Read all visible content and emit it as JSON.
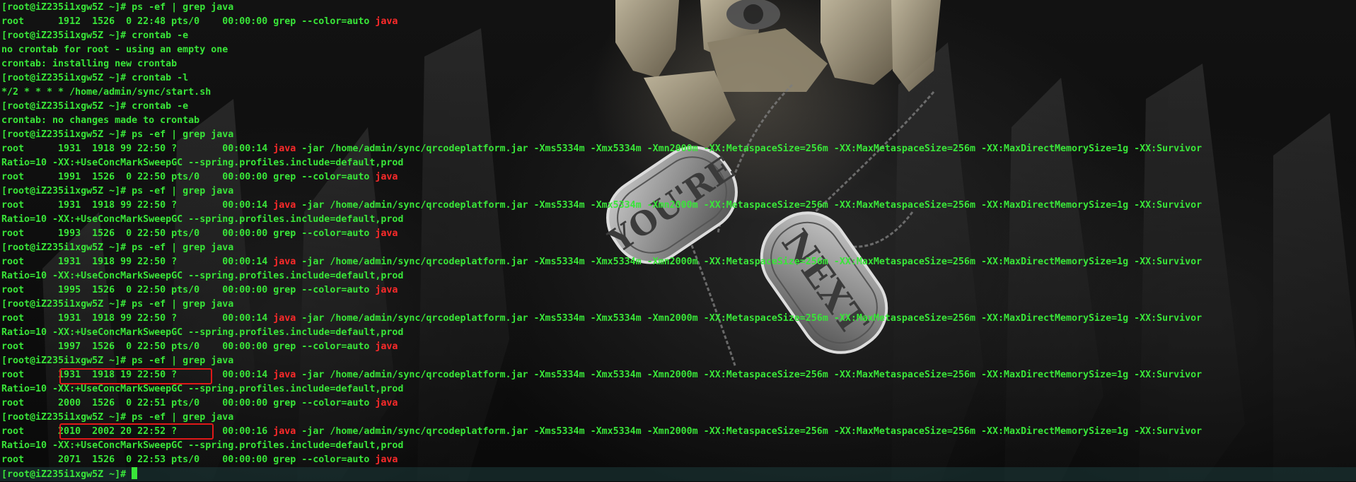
{
  "terminal": {
    "highlight": "java",
    "cursor": "█",
    "lines": [
      "[root@iZ235i1xgw5Z ~]# ps -ef | grep java",
      "root      1912  1526  0 22:48 pts/0    00:00:00 grep --color=auto java",
      "[root@iZ235i1xgw5Z ~]# crontab -e",
      "no crontab for root - using an empty one",
      "crontab: installing new crontab",
      "[root@iZ235i1xgw5Z ~]# crontab -l",
      "*/2 * * * * /home/admin/sync/start.sh",
      "[root@iZ235i1xgw5Z ~]# crontab -e",
      "crontab: no changes made to crontab",
      "[root@iZ235i1xgw5Z ~]# ps -ef | grep java",
      "root      1931  1918 99 22:50 ?        00:00:14 java -jar /home/admin/sync/qrcodeplatform.jar -Xms5334m -Xmx5334m -Xmn2000m -XX:MetaspaceSize=256m -XX:MaxMetaspaceSize=256m -XX:MaxDirectMemorySize=1g -XX:Survivor",
      "Ratio=10 -XX:+UseConcMarkSweepGC --spring.profiles.include=default,prod",
      "root      1991  1526  0 22:50 pts/0    00:00:00 grep --color=auto java",
      "[root@iZ235i1xgw5Z ~]# ps -ef | grep java",
      "root      1931  1918 99 22:50 ?        00:00:14 java -jar /home/admin/sync/qrcodeplatform.jar -Xms5334m -Xmx5334m -Xmn2000m -XX:MetaspaceSize=256m -XX:MaxMetaspaceSize=256m -XX:MaxDirectMemorySize=1g -XX:Survivor",
      "Ratio=10 -XX:+UseConcMarkSweepGC --spring.profiles.include=default,prod",
      "root      1993  1526  0 22:50 pts/0    00:00:00 grep --color=auto java",
      "[root@iZ235i1xgw5Z ~]# ps -ef | grep java",
      "root      1931  1918 99 22:50 ?        00:00:14 java -jar /home/admin/sync/qrcodeplatform.jar -Xms5334m -Xmx5334m -Xmn2000m -XX:MetaspaceSize=256m -XX:MaxMetaspaceSize=256m -XX:MaxDirectMemorySize=1g -XX:Survivor",
      "Ratio=10 -XX:+UseConcMarkSweepGC --spring.profiles.include=default,prod",
      "root      1995  1526  0 22:50 pts/0    00:00:00 grep --color=auto java",
      "[root@iZ235i1xgw5Z ~]# ps -ef | grep java",
      "root      1931  1918 99 22:50 ?        00:00:14 java -jar /home/admin/sync/qrcodeplatform.jar -Xms5334m -Xmx5334m -Xmn2000m -XX:MetaspaceSize=256m -XX:MaxMetaspaceSize=256m -XX:MaxDirectMemorySize=1g -XX:Survivor",
      "Ratio=10 -XX:+UseConcMarkSweepGC --spring.profiles.include=default,prod",
      "root      1997  1526  0 22:50 pts/0    00:00:00 grep --color=auto java",
      "[root@iZ235i1xgw5Z ~]# ps -ef | grep java",
      "root      1931  1918 19 22:50 ?        00:00:14 java -jar /home/admin/sync/qrcodeplatform.jar -Xms5334m -Xmx5334m -Xmn2000m -XX:MetaspaceSize=256m -XX:MaxMetaspaceSize=256m -XX:MaxDirectMemorySize=1g -XX:Survivor",
      "Ratio=10 -XX:+UseConcMarkSweepGC --spring.profiles.include=default,prod",
      "root      2000  1526  0 22:51 pts/0    00:00:00 grep --color=auto java",
      "[root@iZ235i1xgw5Z ~]# ps -ef | grep java",
      "root      2010  2002 20 22:52 ?        00:00:16 java -jar /home/admin/sync/qrcodeplatform.jar -Xms5334m -Xmx5334m -Xmn2000m -XX:MetaspaceSize=256m -XX:MaxMetaspaceSize=256m -XX:MaxDirectMemorySize=1g -XX:Survivor",
      "Ratio=10 -XX:+UseConcMarkSweepGC --spring.profiles.include=default,prod",
      "root      2071  1526  0 22:53 pts/0    00:00:00 grep --color=auto java",
      "[root@iZ235i1xgw5Z ~]# "
    ]
  },
  "wallpaper": {
    "tag_left_text": "YOU'RE",
    "tag_right_text": "NEXT"
  },
  "colors": {
    "text": "#39e639",
    "highlight": "#ff2a2a",
    "box": "#e01818"
  }
}
